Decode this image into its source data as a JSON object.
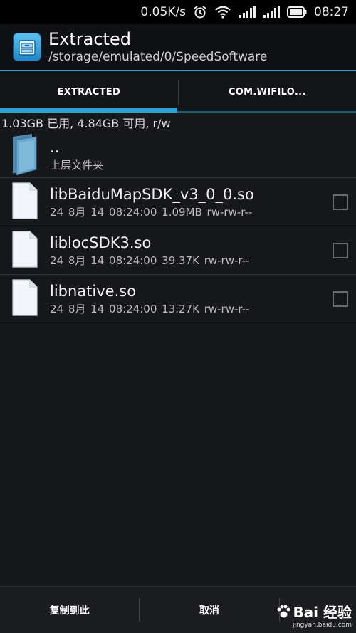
{
  "status": {
    "network_speed": "0.05K/s",
    "time": "08:27",
    "icons": [
      "alarm-icon",
      "wifi-icon",
      "signal-icon",
      "signal-icon",
      "battery-icon"
    ]
  },
  "header": {
    "title": "Extracted",
    "path": "/storage/emulated/0/SpeedSoftware",
    "icon": "file-cabinet-icon"
  },
  "tabs": [
    {
      "label": "EXTRACTED",
      "active": true
    },
    {
      "label": "COM.WIFILO...",
      "active": false
    }
  ],
  "storage_info": "1.03GB 已用, 4.84GB 可用, r/w",
  "parent_folder": {
    "name": "..",
    "label": "上层文件夹",
    "icon": "folder-icon"
  },
  "files": [
    {
      "name": "libBaiduMapSDK_v3_0_0.so",
      "meta": "24 8月 14 08:24:00  1.09MB  rw-rw-r--",
      "icon": "file-icon"
    },
    {
      "name": "liblocSDK3.so",
      "meta": "24 8月 14 08:24:00  39.37K  rw-rw-r--",
      "icon": "file-icon"
    },
    {
      "name": "libnative.so",
      "meta": "24 8月 14 08:24:00  13.27K  rw-rw-r--",
      "icon": "file-icon"
    }
  ],
  "bottom_bar": {
    "copy_here": "复制到此",
    "cancel": "取消"
  },
  "watermark": {
    "text": "Bai 经验",
    "url": "jingyan.baidu.com"
  },
  "colors": {
    "accent": "#2aa3d8",
    "background": "#17181c"
  }
}
